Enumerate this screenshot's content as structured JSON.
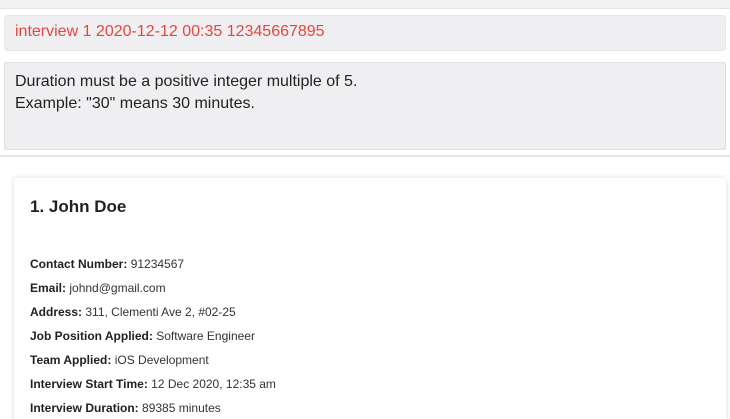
{
  "command_box": {
    "value": "interview 1 2020-12-12 00:35 12345667895"
  },
  "result_box": {
    "lines": [
      "Duration must be a positive integer multiple of 5.",
      "Example: \"30\" means 30 minutes."
    ]
  },
  "applicant_card": {
    "title": "1. John Doe",
    "fields": [
      {
        "label": "Contact Number:",
        "value": "91234567"
      },
      {
        "label": "Email:",
        "value": "johnd@gmail.com"
      },
      {
        "label": "Address:",
        "value": "311, Clementi Ave 2, #02-25"
      },
      {
        "label": "Job Position Applied:",
        "value": "Software Engineer"
      },
      {
        "label": "Team Applied:",
        "value": "iOS Development"
      },
      {
        "label": "Interview Start Time:",
        "value": "12 Dec 2020, 12:35 am"
      },
      {
        "label": "Interview Duration:",
        "value": "89385 minutes"
      }
    ]
  },
  "colors": {
    "command_error_text": "#e8453c",
    "panel_background": "#efeff1"
  }
}
